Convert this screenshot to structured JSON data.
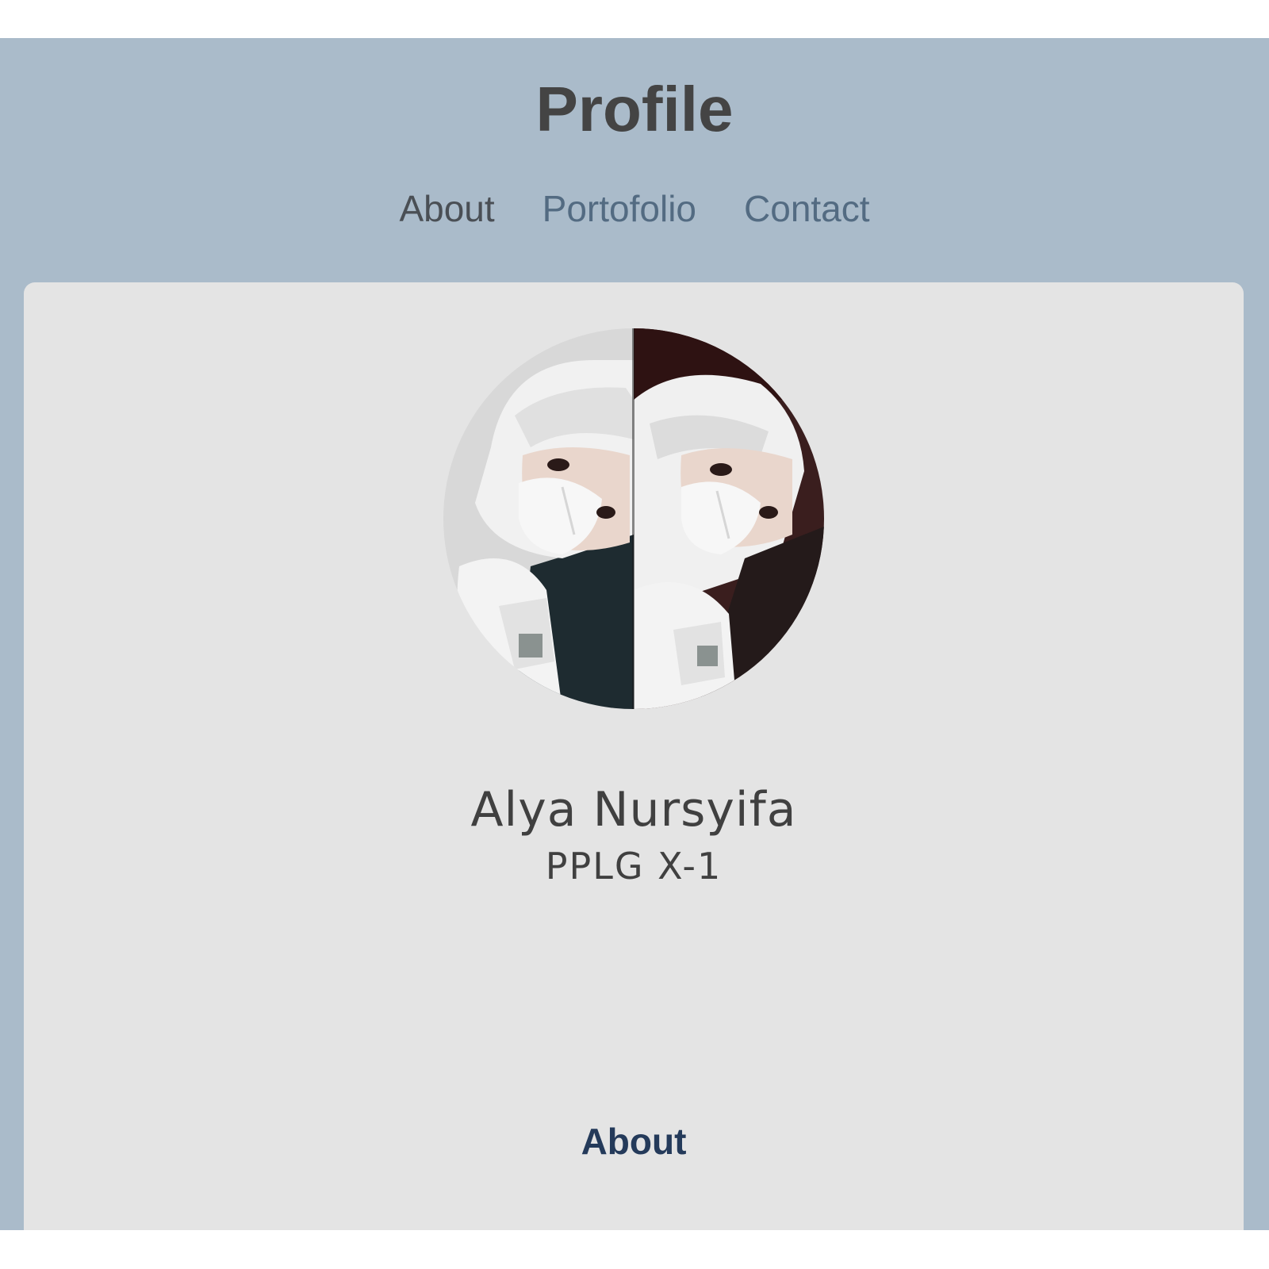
{
  "header": {
    "title": "Profile",
    "nav": {
      "about": "About",
      "portfolio": "Portofolio",
      "contact": "Contact"
    }
  },
  "profile": {
    "photo_description": "profile-photo",
    "name": "Alya Nursyifa",
    "class": "PPLG X-1"
  },
  "sections": {
    "about_heading": "About"
  },
  "colors": {
    "page_background": "#aabbca",
    "card_background": "#e4e4e4",
    "title_color": "#444444",
    "nav_active_color": "#4a4f55",
    "nav_link_color": "#536b82",
    "heading_color": "#243a5a"
  }
}
